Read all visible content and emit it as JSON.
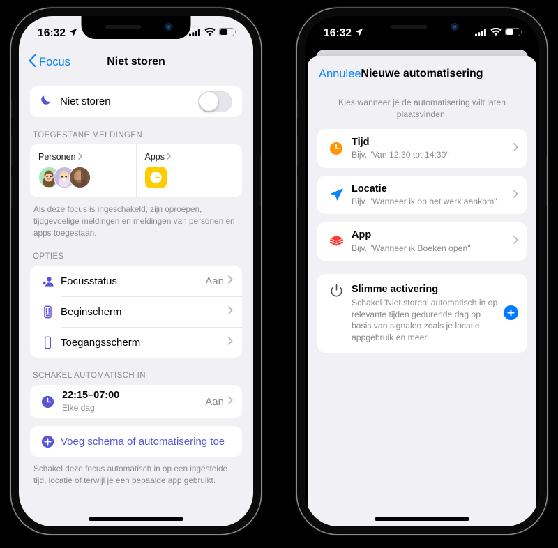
{
  "left_phone": {
    "status_bar": {
      "time": "16:32",
      "location_icon": "location-arrow-icon",
      "cellular_icon": "cellular-bars-icon",
      "wifi_icon": "wifi-icon",
      "battery_icon": "battery-icon",
      "battery_level": 50
    },
    "nav": {
      "back_label": "Focus",
      "back_icon": "chevron-left-icon",
      "title": "Niet storen"
    },
    "focus_toggle": {
      "icon": "moon-icon",
      "label": "Niet storen",
      "enabled": false
    },
    "allowed_section": {
      "header": "TOEGESTANE MELDINGEN",
      "people": {
        "title": "Personen",
        "chevron": "chevron-right-icon",
        "avatars": [
          "memoji-green",
          "memoji-purple",
          "photo-brown"
        ]
      },
      "apps": {
        "title": "Apps",
        "chevron": "chevron-right-icon",
        "tiles": [
          {
            "name": "clock-app-icon",
            "color": "#ffcc00"
          }
        ]
      },
      "footnote": "Als deze focus is ingeschakeld, zijn oproepen, tijdgevoelige meldingen en meldingen van personen en apps toegestaan."
    },
    "options_section": {
      "header": "OPTIES",
      "rows": [
        {
          "icon": "focus-status-icon",
          "label": "Focusstatus",
          "value": "Aan",
          "chevron": "chevron-right-icon"
        },
        {
          "icon": "home-screen-icon",
          "label": "Beginscherm",
          "value": "",
          "chevron": "chevron-right-icon"
        },
        {
          "icon": "lock-screen-icon",
          "label": "Toegangsscherm",
          "value": "",
          "chevron": "chevron-right-icon"
        }
      ]
    },
    "schedule_section": {
      "header": "SCHAKEL AUTOMATISCH IN",
      "schedule": {
        "icon": "clock-icon",
        "title": "22:15–07:00",
        "subtitle": "Elke dag",
        "value": "Aan",
        "chevron": "chevron-right-icon"
      },
      "add_row": {
        "icon": "plus-circle-icon",
        "label": "Voeg schema of automatisering toe"
      },
      "footnote": "Schakel deze focus automatisch in op een ingestelde tijd, locatie of terwijl je een bepaalde app gebruikt."
    }
  },
  "right_phone": {
    "status_bar": {
      "time": "16:32",
      "location_icon": "location-arrow-icon",
      "cellular_icon": "cellular-bars-icon",
      "wifi_icon": "wifi-icon",
      "battery_icon": "battery-icon",
      "battery_level": 50
    },
    "sheet": {
      "cancel_label": "Annuleer",
      "title": "Nieuwe automatisering",
      "intro": "Kies wanneer je de automatisering wilt laten plaatsvinden.",
      "options": [
        {
          "icon": "clock-icon",
          "color": "#ff9500",
          "title": "Tijd",
          "subtitle": "Bijv. \"Van 12:30 tot 14:30\"",
          "chevron": "chevron-right-icon"
        },
        {
          "icon": "location-arrow-icon",
          "color": "#0a84ff",
          "title": "Locatie",
          "subtitle": "Bijv. \"Wanneer ik op het werk aankom\"",
          "chevron": "chevron-right-icon"
        },
        {
          "icon": "app-stack-icon",
          "color": "#ff3b30",
          "title": "App",
          "subtitle": "Bijv. \"Wanneer ik Boeken open\"",
          "chevron": "chevron-right-icon"
        }
      ],
      "smart_activation": {
        "icon": "power-icon",
        "title": "Slimme activering",
        "description": "Schakel 'Niet storen' automatisch in op relevante tijden gedurende dag op basis van signalen zoals je locatie, appgebruik en meer.",
        "add_icon": "plus-circle-icon",
        "add_color": "#007aff"
      }
    }
  },
  "theme": {
    "screen_bg": "#f1f0f5",
    "card_bg": "#ffffff",
    "accent_blue": "#0a84ff",
    "accent_purple": "#5856d6",
    "secondary_text": "#8a8a90"
  }
}
